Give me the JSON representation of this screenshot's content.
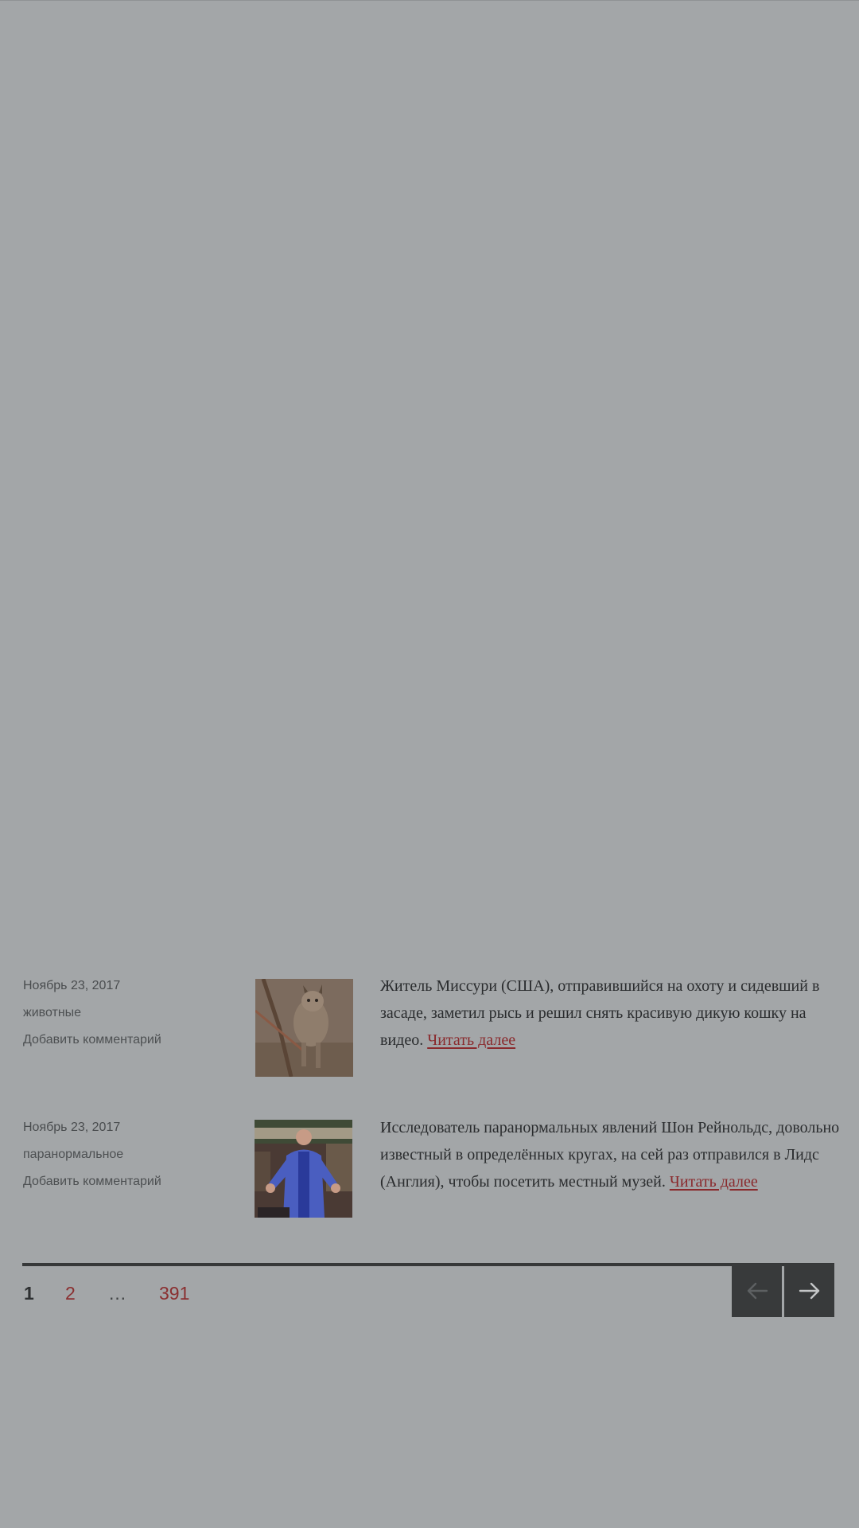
{
  "posts": [
    {
      "date": "Ноябрь 23, 2017",
      "category": "животные",
      "comment_link": "Добавить комментарий",
      "thumbnail": "lynx-photo",
      "excerpt": "Житель Миссури (США), отправившийся на охоту и сидевший в засаде, заметил рысь и решил снять красивую дикую кошку на видео.",
      "read_more": "Читать далее"
    },
    {
      "date": "Ноябрь 23, 2017",
      "category": "паранормальное",
      "comment_link": "Добавить комментарий",
      "thumbnail": "man-in-blue-jacket-photo",
      "excerpt": "Исследователь паранормальных явлений Шон Рейнольдс, довольно известный в определённых кругах, на сей раз отправился в Лидс (Англия), чтобы посетить местный музей.",
      "read_more": "Читать далее"
    }
  ],
  "pagination": {
    "current": "1",
    "next_page": "2",
    "ellipsis": "…",
    "last_page": "391",
    "prev_icon": "arrow-left-icon",
    "next_icon": "arrow-right-icon"
  },
  "colors": {
    "overlay_background": "#a3a6a8",
    "link_accent": "#8a2a2d",
    "nav_button": "#383a3b"
  }
}
